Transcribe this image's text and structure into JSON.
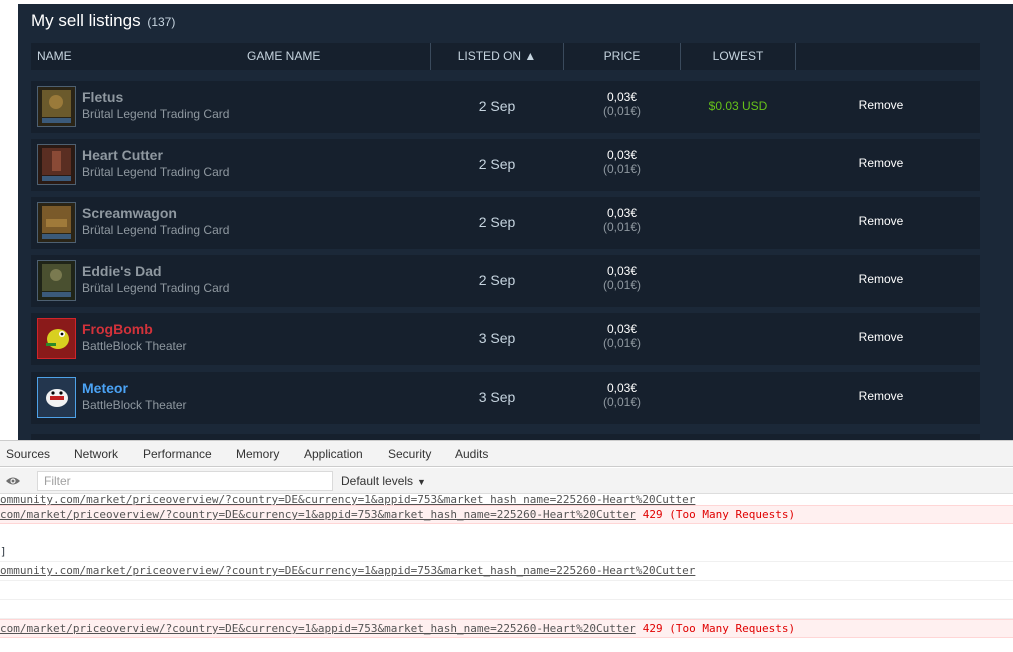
{
  "market": {
    "title": "My sell listings",
    "count": "(137)",
    "headers": {
      "name": "NAME",
      "game": "GAME NAME",
      "listed": "LISTED ON ▲",
      "price": "PRICE",
      "lowest": "LOWEST"
    },
    "listings": [
      {
        "name": "Fletus",
        "game": "Brütal Legend Trading Card",
        "date": "2 Sep",
        "price": "0,03€",
        "fee": "(0,01€)",
        "lowest": "$0.03 USD",
        "remove": "Remove",
        "name_color": "#8f98a0"
      },
      {
        "name": "Heart Cutter",
        "game": "Brütal Legend Trading Card",
        "date": "2 Sep",
        "price": "0,03€",
        "fee": "(0,01€)",
        "lowest": "",
        "remove": "Remove",
        "name_color": "#8f98a0"
      },
      {
        "name": "Screamwagon",
        "game": "Brütal Legend Trading Card",
        "date": "2 Sep",
        "price": "0,03€",
        "fee": "(0,01€)",
        "lowest": "",
        "remove": "Remove",
        "name_color": "#8f98a0"
      },
      {
        "name": "Eddie's Dad",
        "game": "Brütal Legend Trading Card",
        "date": "2 Sep",
        "price": "0,03€",
        "fee": "(0,01€)",
        "lowest": "",
        "remove": "Remove",
        "name_color": "#8f98a0"
      },
      {
        "name": "FrogBomb",
        "game": "BattleBlock Theater",
        "date": "3 Sep",
        "price": "0,03€",
        "fee": "(0,01€)",
        "lowest": "",
        "remove": "Remove",
        "name_color": "#d2323a"
      },
      {
        "name": "Meteor",
        "game": "BattleBlock Theater",
        "date": "3 Sep",
        "price": "0,03€",
        "fee": "(0,01€)",
        "lowest": "",
        "remove": "Remove",
        "name_color": "#4ba3f5"
      }
    ]
  },
  "devtools": {
    "tabs": [
      "Sources",
      "Network",
      "Performance",
      "Memory",
      "Application",
      "Security",
      "Audits"
    ],
    "filter_placeholder": "Filter",
    "levels_label": "Default levels",
    "console_lines": [
      {
        "type": "log",
        "url": "ommunity.com/market/priceoverview/?country=DE&currency=1&appid=753&market_hash_name=225260-Heart%20Cutter",
        "status": ""
      },
      {
        "type": "error",
        "url": "com/market/priceoverview/?country=DE&currency=1&appid=753&market_hash_name=225260-Heart%20Cutter",
        "status": "429 (Too Many Requests)"
      },
      {
        "type": "log",
        "url": "",
        "status": "",
        "text": "]"
      },
      {
        "type": "log",
        "url": "ommunity.com/market/priceoverview/?country=DE&currency=1&appid=753&market_hash_name=225260-Heart%20Cutter",
        "status": ""
      },
      {
        "type": "log",
        "url": "",
        "status": ""
      },
      {
        "type": "log",
        "url": "",
        "status": ""
      },
      {
        "type": "error",
        "url": "com/market/priceoverview/?country=DE&currency=1&appid=753&market_hash_name=225260-Heart%20Cutter",
        "status": "429 (Too Many Requests)"
      }
    ]
  },
  "colors": {
    "panel_bg": "#1b2838",
    "row_bg": "#16202d",
    "lowest_green": "#66c31a",
    "error_red": "#ff0000"
  },
  "icons": {
    "filter_toggle": "eye-icon",
    "levels_caret": "caret-down-icon"
  }
}
